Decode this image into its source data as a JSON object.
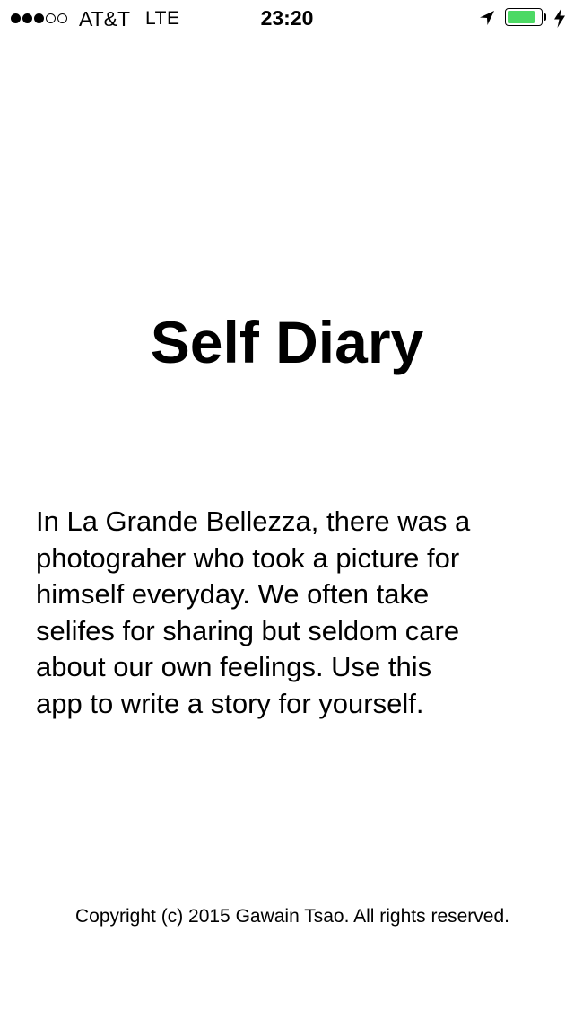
{
  "status_bar": {
    "signal": {
      "filled": 3,
      "total": 5
    },
    "carrier": "AT&T",
    "network": "LTE",
    "time": "23:20",
    "location_icon": "location-arrow-icon",
    "battery_level": 0.82,
    "battery_color": "#4cd964",
    "charging_icon": "bolt-icon"
  },
  "main": {
    "title": "Self Diary",
    "intro_lines": [
      "In La Grande Bellezza, there was a",
      "photograher who took a picture for",
      "himself everyday. We often take",
      "selifes for sharing but seldom care",
      "about our own feelings. Use this",
      "app to write a story for yourself."
    ]
  },
  "footer": {
    "copyright": "Copyright (c) 2015 Gawain Tsao. All rights reserved."
  }
}
